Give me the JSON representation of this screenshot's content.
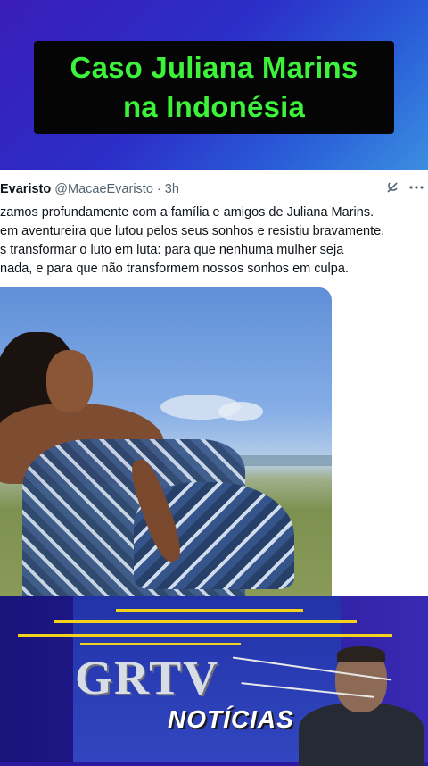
{
  "headline": {
    "line1": "Caso Juliana Marins",
    "line2": "na Indonésia"
  },
  "tweet": {
    "author_name": "Evaristo",
    "handle": "@MacaeEvaristo",
    "separator": "·",
    "time": "3h",
    "lines": [
      "zamos profundamente com a família e amigos de Juliana Marins.",
      "em aventureira que lutou pelos seus sonhos e resistiu bravamente.",
      "s transformar o luto em luta: para que nenhuma mulher seja",
      "nada, e para que não transformem nossos sonhos em culpa."
    ]
  },
  "icons": {
    "grok": "grok-icon",
    "more": "more-options-icon"
  },
  "logo": {
    "brand": "GRTV",
    "subtitle": "NOTÍCIAS"
  },
  "colors": {
    "headline_text": "#3df23a",
    "headline_bg": "#050505",
    "accent_yellow": "#f2d21b",
    "banner_bg": "#2a1c9c"
  }
}
